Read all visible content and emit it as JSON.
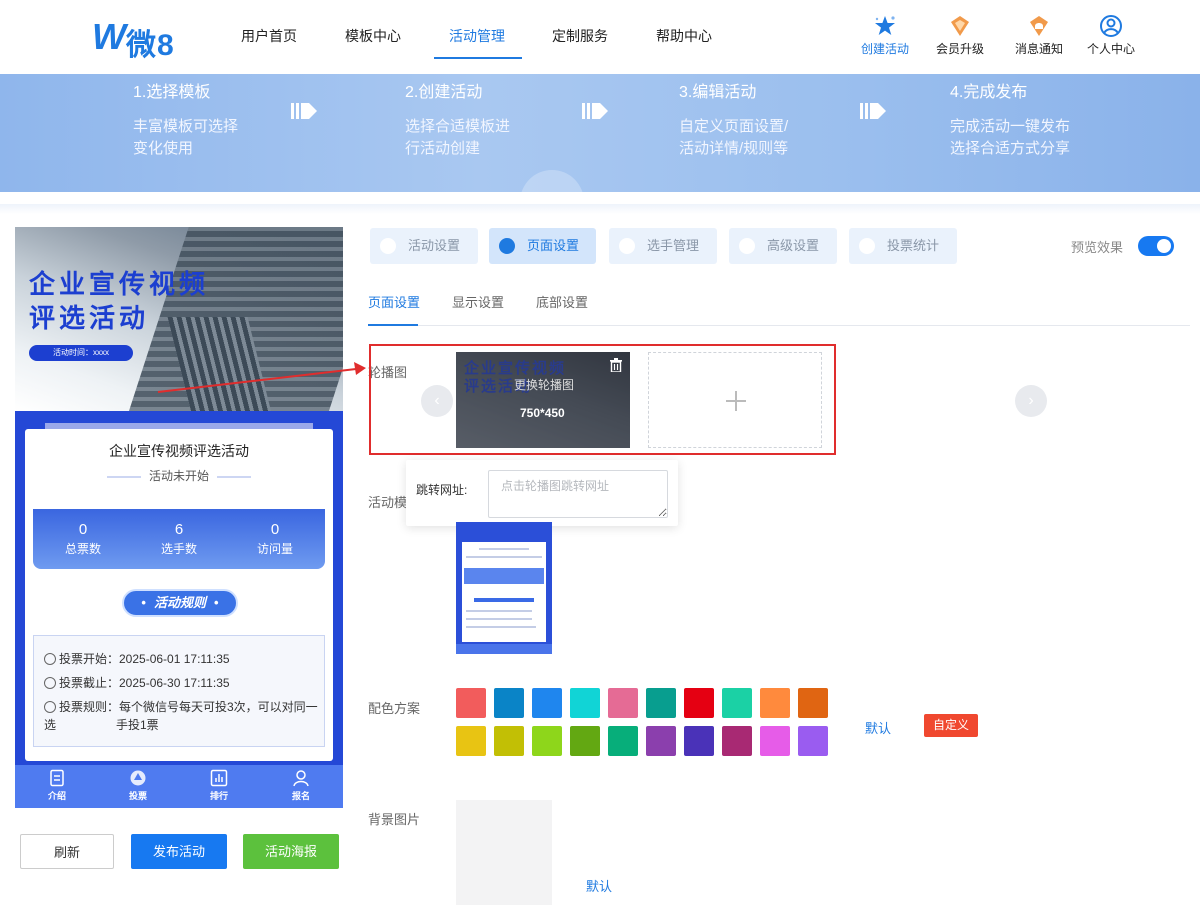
{
  "brand": {
    "name": "微8"
  },
  "nav": {
    "items": [
      {
        "label": "用户首页"
      },
      {
        "label": "模板中心"
      },
      {
        "label": "活动管理"
      },
      {
        "label": "定制服务"
      },
      {
        "label": "帮助中心"
      }
    ],
    "right": [
      {
        "label": "创建活动",
        "icon": "star-icon"
      },
      {
        "label": "会员升级",
        "icon": "vip-icon"
      },
      {
        "label": "消息通知",
        "icon": "bell-icon"
      },
      {
        "label": "个人中心",
        "icon": "user-icon"
      }
    ]
  },
  "steps": [
    {
      "title": "1.选择模板",
      "desc1": "丰富模板可选择",
      "desc2": "变化使用"
    },
    {
      "title": "2.创建活动",
      "desc1": "选择合适模板进",
      "desc2": "行活动创建"
    },
    {
      "title": "3.编辑活动",
      "desc1": "自定义页面设置/",
      "desc2": "活动详情/规则等"
    },
    {
      "title": "4.完成发布",
      "desc1": "完成活动一键发布",
      "desc2": "选择合适方式分享"
    }
  ],
  "preview": {
    "hero_title_line1": "企业宣传视频",
    "hero_title_line2": "评选活动",
    "hero_time": "活动时间：xxxx",
    "name": "企业宣传视频评选活动",
    "status": "活动未开始",
    "stats": [
      {
        "value": "0",
        "label": "总票数"
      },
      {
        "value": "6",
        "label": "选手数"
      },
      {
        "value": "0",
        "label": "访问量"
      }
    ],
    "rules_button": "活动规则",
    "vote_start": "投票开始：2025-06-01 17:11:35",
    "vote_end": "投票截止：2025-06-30 17:11:35",
    "vote_rule_line1": "投票规则：每个微信号每天可投3次，可以对同一选",
    "vote_rule_line2": "手投1票",
    "tabs": [
      {
        "label": "介绍",
        "icon": "document-icon"
      },
      {
        "label": "投票",
        "icon": "vote-icon"
      },
      {
        "label": "排行",
        "icon": "chart-icon"
      },
      {
        "label": "报名",
        "icon": "person-icon"
      }
    ]
  },
  "buttons": {
    "refresh": "刷新",
    "publish": "发布活动",
    "poster": "活动海报"
  },
  "settings_tabs": [
    {
      "label": "活动设置"
    },
    {
      "label": "页面设置"
    },
    {
      "label": "选手管理"
    },
    {
      "label": "高级设置"
    },
    {
      "label": "投票统计"
    }
  ],
  "preview_toggle": {
    "label": "预览效果",
    "on": true
  },
  "sub_tabs": [
    {
      "label": "页面设置"
    },
    {
      "label": "显示设置"
    },
    {
      "label": "底部设置"
    }
  ],
  "carousel": {
    "label": "轮播图",
    "image_title_line1": "企业宣传视频",
    "image_title_line2": "评选活动",
    "replace_text": "更换轮播图",
    "size_text": "750*450",
    "url_label": "跳转网址:",
    "url_placeholder": "点击轮播图跳转网址",
    "url_value": ""
  },
  "template": {
    "label": "活动模板"
  },
  "colors": {
    "label": "配色方案",
    "swatches": [
      "#f25c5c",
      "#0a84c7",
      "#1f86ee",
      "#11d4d6",
      "#e56b95",
      "#089e8f",
      "#e50012",
      "#1bd1a5",
      "#ff8a3d",
      "#e06512",
      "#e8c413",
      "#c2bf05",
      "#8ed61b",
      "#63a812",
      "#07ae7a",
      "#8b3fad",
      "#4a32b8",
      "#a82973",
      "#e65ce8",
      "#9a5cf0"
    ],
    "default": "默认",
    "custom": "自定义"
  },
  "background": {
    "label": "背景图片",
    "default": "默认"
  }
}
